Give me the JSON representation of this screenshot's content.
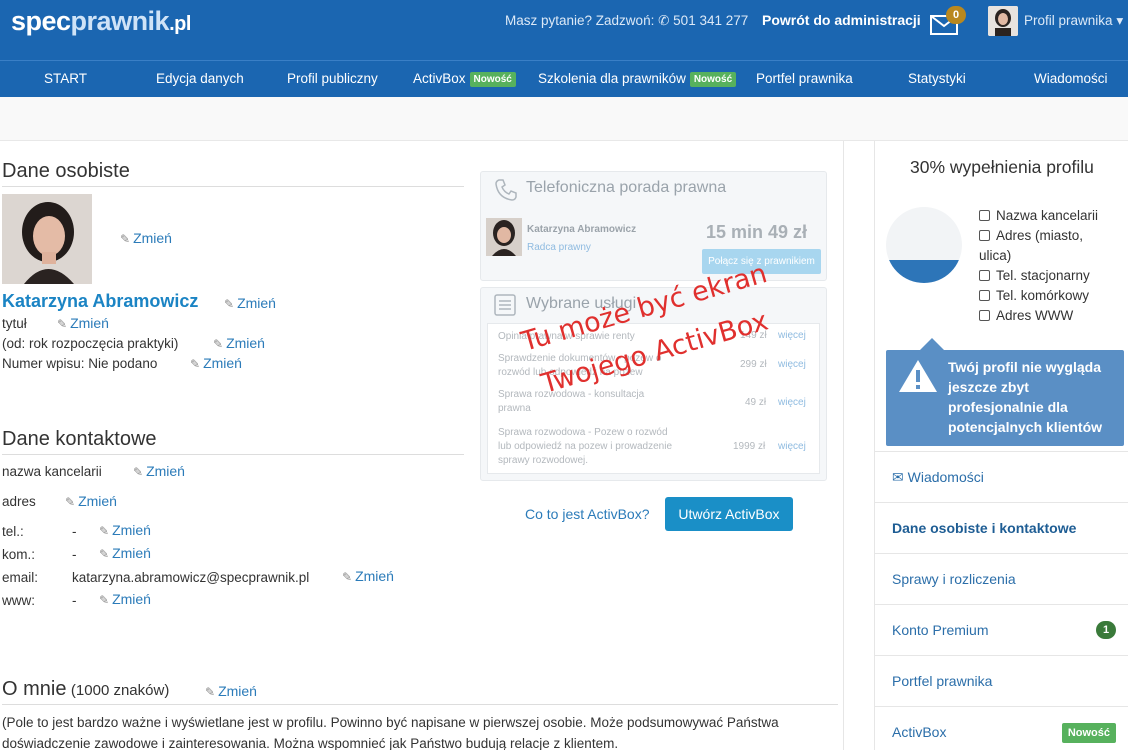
{
  "header": {
    "logo_part1": "spec",
    "logo_part2": "prawnik",
    "logo_part3": ".pl",
    "phone_text": "Masz pytanie? Zadzwoń:",
    "phone_number": "501 341 277",
    "back_admin": "Powrót do administracji",
    "mail_count": "0",
    "profile_menu": "Profil prawnika"
  },
  "nav": {
    "items": [
      {
        "label": "START"
      },
      {
        "label": "Edycja danych"
      },
      {
        "label": "Profil publiczny"
      },
      {
        "label": "ActivBox",
        "badge": "Nowość"
      },
      {
        "label": "Szkolenia dla prawników",
        "badge": "Nowość"
      },
      {
        "label": "Portfel prawnika"
      },
      {
        "label": "Statystyki"
      },
      {
        "label": "Wiadomości"
      }
    ]
  },
  "personal": {
    "heading": "Dane osobiste",
    "change": "Zmień",
    "name": "Katarzyna Abramowicz",
    "title_label": "tytuł",
    "since_label": "(od: rok rozpoczęcia praktyki)",
    "reg_label": "Numer wpisu: Nie podano"
  },
  "contact": {
    "heading": "Dane kontaktowe",
    "office_label": "nazwa kancelarii",
    "address_label": "adres",
    "tel_label": "tel.:",
    "tel_value": "-",
    "mob_label": "kom.:",
    "mob_value": "-",
    "email_label": "email:",
    "email_value": "katarzyna.abramowicz@specprawnik.pl",
    "www_label": "www:",
    "www_value": "-"
  },
  "about": {
    "heading": "O mnie",
    "limit": "(1000 znaków)",
    "text": "(Pole to jest bardzo ważne i wyświetlane jest w profilu. Powinno być napisane w pierwszej osobie. Może podsumowywać Państwa doświadczenie zawodowe i zainteresowania. Można wspomnieć jak Państwo budują relacje z klientem."
  },
  "activbox": {
    "phone_title": "Telefoniczna porada prawna",
    "lawyer_name": "Katarzyna Abramowicz",
    "lawyer_role": "Radca prawny",
    "price": "15 min 49 zł",
    "call_btn": "Połącz się z prawnikiem",
    "services_title": "Wybrane usługi",
    "services": [
      {
        "name": "Opinia prawna w sprawie renty",
        "price": "149 zł",
        "more": "więcej"
      },
      {
        "name": "Sprawdzenie dokumentów - pozew o rozwód lub odpowiedź na pozew",
        "price": "299 zł",
        "more": "więcej"
      },
      {
        "name": "Sprawa rozwodowa - konsultacja prawna",
        "price": "49 zł",
        "more": "więcej"
      },
      {
        "name": "Sprawa rozwodowa - Pozew o rozwód lub odpowiedź na pozew i prowadzenie sprawy rozwodowej.",
        "price": "1999 zł",
        "more": "więcej"
      }
    ],
    "watermark_line1": "Tu może być ekran",
    "watermark_line2": "Twojego ActivBox",
    "what_link": "Co to jest ActivBox?",
    "create_btn": "Utwórz ActivBox"
  },
  "sidebar": {
    "completion_title": "30% wypełnienia profilu",
    "completion_pct": 30,
    "checklist": [
      "Nazwa kancelarii",
      "Adres (miasto, ulica)",
      "Tel. stacjonarny",
      "Tel. komórkowy",
      "Adres WWW"
    ],
    "warning": "Twój profil nie wygląda jeszcze zbyt profesjonalnie dla potencjalnych klientów",
    "menu": [
      {
        "label": "Wiadomości"
      },
      {
        "label": "Dane osobiste i kontaktowe"
      },
      {
        "label": "Sprawy i rozliczenia"
      },
      {
        "label": "Konto Premium",
        "count": "1"
      },
      {
        "label": "Portfel prawnika"
      },
      {
        "label": "ActivBox",
        "badge": "Nowość"
      }
    ]
  },
  "colors": {
    "brand": "#1b66b1",
    "link": "#2b7bb9",
    "new_badge": "#57b15d",
    "watermark": "#e0302e"
  }
}
